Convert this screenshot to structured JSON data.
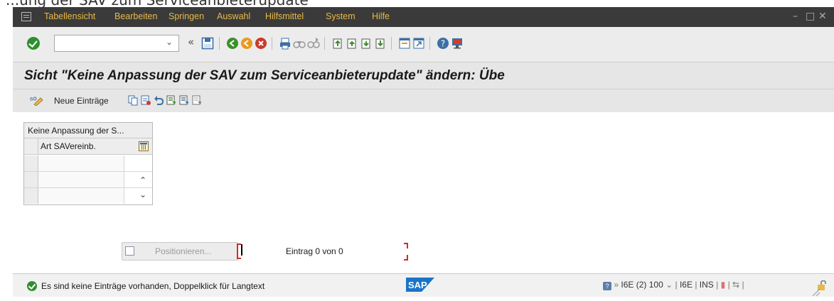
{
  "top_strip": {
    "text": "...ung der SAV zum Serviceanbieterupdate"
  },
  "menubar": {
    "items": [
      "Tabellensicht",
      "Bearbeiten",
      "Springen",
      "Auswahl",
      "Hilfsmittel",
      "System",
      "Hilfe"
    ]
  },
  "toolbar": {
    "command_value": "",
    "command_placeholder": "",
    "icons": [
      "enter-icon",
      "back-icon",
      "exit-icon",
      "cancel-icon",
      "print-icon",
      "find-icon",
      "find-next-icon",
      "first-page-icon",
      "previous-page-icon",
      "next-page-icon",
      "last-page-icon",
      "new-session-icon",
      "shortcut-icon",
      "help-icon",
      "customize-layout-icon"
    ]
  },
  "title": "Sicht \"Keine Anpassung der SAV  zum Serviceanbieterupdate\" ändern: Übe",
  "app_toolbar": {
    "new_entries_label": "Neue Einträge"
  },
  "table": {
    "header": "Keine Anpassung der S...",
    "column": "Art SAVereinb.",
    "rows": [
      "",
      "",
      ""
    ]
  },
  "position": {
    "button_label": "Positionieren...",
    "entry_text": "Eintrag 0 von 0"
  },
  "status": {
    "message": "Es sind keine Einträge vorhanden, Doppelklick für Langtext",
    "system": "I6E (2) 100",
    "server": "I6E",
    "mode": "INS"
  },
  "colors": {
    "menubar": "#3a3a3a",
    "menu_text": "#e8b84a",
    "ok_green": "#2e8f2e",
    "error_red": "#d12b2b"
  }
}
